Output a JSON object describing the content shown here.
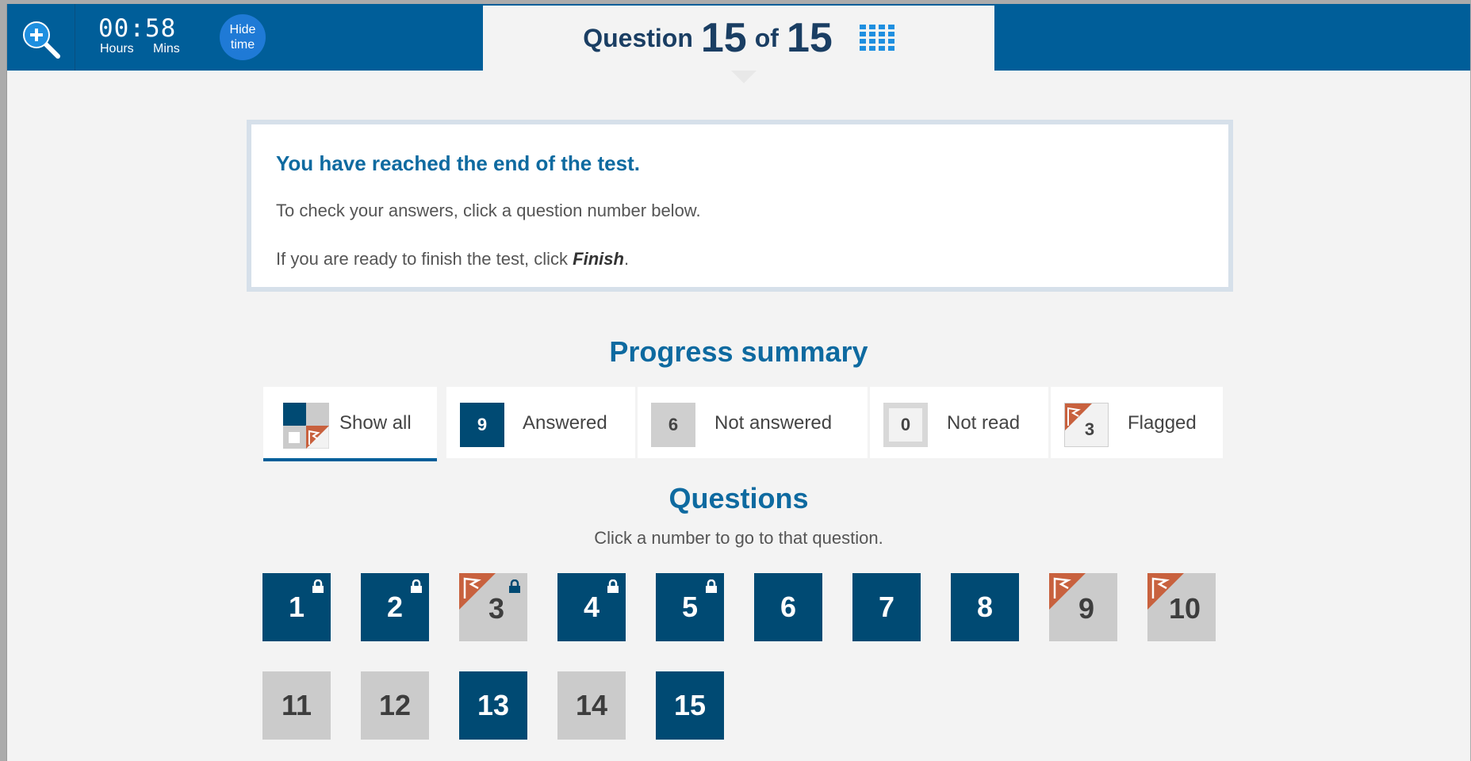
{
  "header": {
    "timer": {
      "hours": "00",
      "mins": "58",
      "hours_label": "Hours",
      "mins_label": "Mins"
    },
    "hide_time_line1": "Hide",
    "hide_time_line2": "time",
    "question_word": "Question",
    "current": "15",
    "of_word": "of",
    "total": "15"
  },
  "end_message": {
    "title": "You have reached the end of the test.",
    "line1": "To check your answers, click a question number below.",
    "line2_prefix": "If you are ready to finish the test, click ",
    "line2_bold": "Finish",
    "line2_suffix": "."
  },
  "progress": {
    "title": "Progress summary",
    "filters": [
      {
        "label": "Show all",
        "active": true
      },
      {
        "label": "Answered",
        "count": "9"
      },
      {
        "label": "Not answered",
        "count": "6"
      },
      {
        "label": "Not read",
        "count": "0"
      },
      {
        "label": "Flagged",
        "count": "3"
      }
    ]
  },
  "questions": {
    "title": "Questions",
    "subtitle": "Click a number to go to that question.",
    "items": [
      {
        "num": "1",
        "state": "answered",
        "locked": true,
        "flagged": false
      },
      {
        "num": "2",
        "state": "answered",
        "locked": true,
        "flagged": false
      },
      {
        "num": "3",
        "state": "unanswered",
        "locked": true,
        "flagged": true
      },
      {
        "num": "4",
        "state": "answered",
        "locked": true,
        "flagged": false
      },
      {
        "num": "5",
        "state": "answered",
        "locked": true,
        "flagged": false
      },
      {
        "num": "6",
        "state": "answered",
        "locked": false,
        "flagged": false
      },
      {
        "num": "7",
        "state": "answered",
        "locked": false,
        "flagged": false
      },
      {
        "num": "8",
        "state": "answered",
        "locked": false,
        "flagged": false
      },
      {
        "num": "9",
        "state": "unanswered",
        "locked": false,
        "flagged": true
      },
      {
        "num": "10",
        "state": "unanswered",
        "locked": false,
        "flagged": true
      },
      {
        "num": "11",
        "state": "unanswered",
        "locked": false,
        "flagged": false
      },
      {
        "num": "12",
        "state": "unanswered",
        "locked": false,
        "flagged": false
      },
      {
        "num": "13",
        "state": "answered",
        "locked": false,
        "flagged": false
      },
      {
        "num": "14",
        "state": "unanswered",
        "locked": false,
        "flagged": false
      },
      {
        "num": "15",
        "state": "answered",
        "locked": false,
        "flagged": false
      }
    ]
  },
  "colors": {
    "header_blue": "#005e99",
    "answered": "#004a73",
    "unanswered": "#cbcbcb",
    "flag": "#c8613e",
    "heading": "#0e6aa0"
  },
  "icons": [
    "zoom-in-icon",
    "question-grid-icon",
    "lock-icon",
    "flag-icon"
  ]
}
